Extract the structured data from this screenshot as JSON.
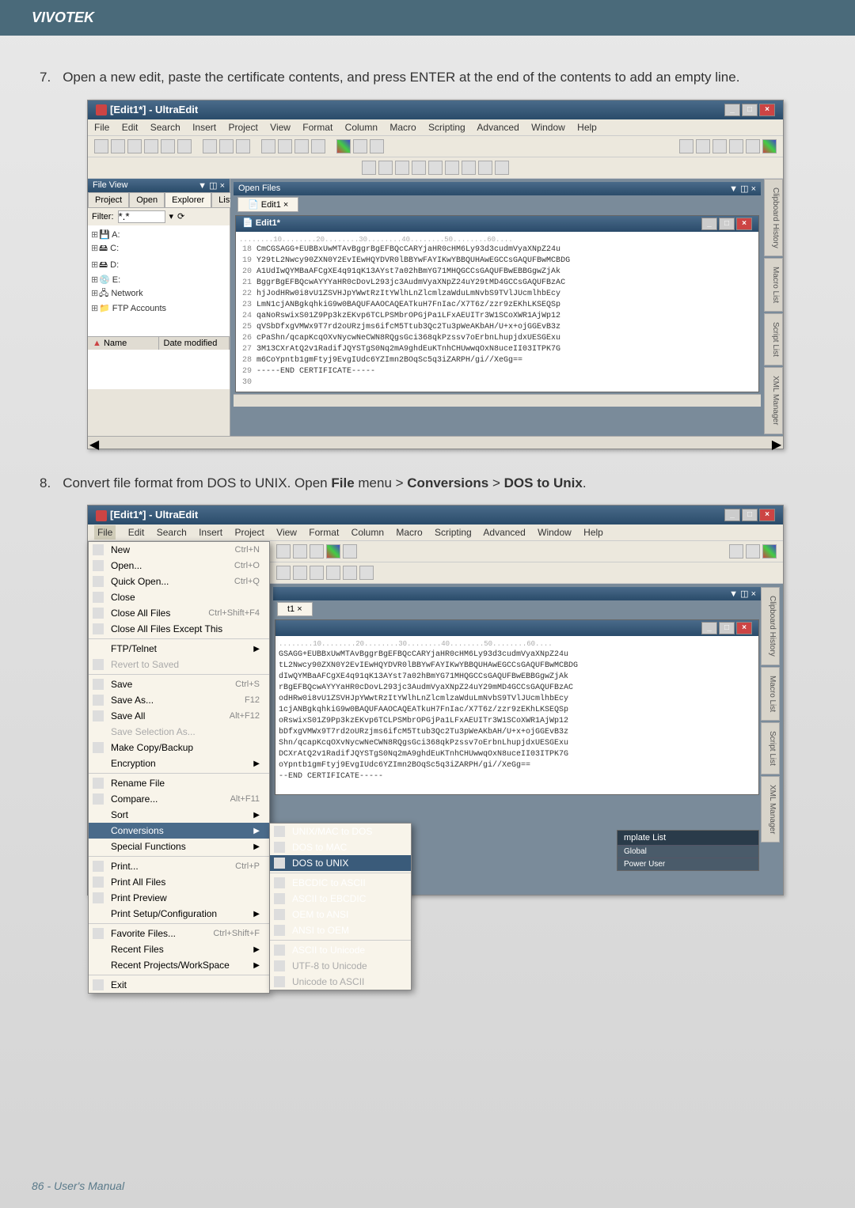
{
  "header": {
    "brand": "VIVOTEK"
  },
  "steps": {
    "step7": {
      "number": "7.",
      "text": "Open a new edit, paste the certificate contents, and press ENTER at the end of the contents to add an empty line."
    },
    "step8": {
      "number": "8.",
      "text_before": "Convert file format from DOS to UNIX. Open ",
      "bold1": "File",
      "text_mid1": " menu > ",
      "bold2": "Conversions",
      "text_mid2": " > ",
      "bold3": "DOS to Unix",
      "text_after": "."
    }
  },
  "window1": {
    "title": "[Edit1*] - UltraEdit",
    "menubar": {
      "file": "File",
      "edit": "Edit",
      "search": "Search",
      "insert": "Insert",
      "project": "Project",
      "view": "View",
      "format": "Format",
      "column": "Column",
      "macro": "Macro",
      "scripting": "Scripting",
      "advanced": "Advanced",
      "window": "Window",
      "help": "Help"
    },
    "leftpanel": {
      "header": "File View",
      "tabs": {
        "project": "Project",
        "open": "Open",
        "explorer": "Explorer",
        "lists": "Lists"
      },
      "filter_label": "Filter:",
      "filter_value": "*.*",
      "tree": {
        "a": "A:",
        "c": "C:",
        "d": "D:",
        "e": "E:",
        "network": "Network",
        "ftp": "FTP Accounts"
      },
      "list_cols": {
        "name": "Name",
        "date": "Date modified"
      }
    },
    "editor": {
      "tab_name": "Edit1",
      "tab_close": "×",
      "doc_title": "Edit1*",
      "ruler": "........10........20........30........40........50........60....",
      "lines": [
        "CmCGSAGG+EUBBxUwMTAvBggrBgEFBQcCARYjaHR0cHM6Ly93d3cudmVyaXNpZ24u",
        "Y29tL2Nwcy90ZXN0Y2EvIEwHQYDVR0lBBYwFAYIKwYBBQUHAwEGCCsGAQUFBwMCBDG",
        "A1UdIwQYMBaAFCgXE4q91qK13AYst7a02hBmYG71MHQGCCsGAQUFBwEBBGgwZjAk",
        "BggrBgEFBQcwAYYYaHR0cDovL293jc3AudmVyaXNpZ24uY29tMD4GCCsGAQUFBzAC",
        "hjJodHRw0i8vU1ZSVHJpYWwtRzItYWlhLnZlcmlzaWduLmNvbS9TVlJUcmlhbEcy",
        "LmN1cjANBgkqhkiG9w0BAQUFAAOCAQEATkuH7FnIac/X7T6z/zzr9zEKhLKSEQSp",
        "qaNoRswixS01Z9Pp3kzEKvp6TCLPSMbrOPGjPa1LFxAEUITr3W1SCoXWR1AjWp12",
        "qVSbDfxgVMWx9T7rd2oURzjms6ifcM5Ttub3Qc2Tu3pWeAKbAH/U+x+ojGGEvB3z",
        "cPaShn/qcapKcqOXvNycwNeCWN8RQgsGci368qkPzssv7oErbnLhupjdxUESGExu",
        "3M13CXrAtQ2v1RadifJQYSTgS0Nq2mA9ghdEuKTnhCHUwwqOxN8uceII03ITPK7G",
        "m6CoYpntb1gmFtyj9EvgIUdc6YZImn2BOqSc5q3iZARPH/gi//XeGg==",
        "-----END CERTIFICATE-----"
      ],
      "line_start": 18
    },
    "right_tabs": {
      "clipboard": "Clipboard History",
      "macro": "Macro List",
      "script": "Script List",
      "xml": "XML Manager"
    }
  },
  "window2": {
    "title": "[Edit1*] - UltraEdit",
    "filemenu": {
      "items": [
        {
          "label": "New",
          "shortcut": "Ctrl+N",
          "icon": true
        },
        {
          "label": "Open...",
          "shortcut": "Ctrl+O",
          "icon": true
        },
        {
          "label": "Quick Open...",
          "shortcut": "Ctrl+Q",
          "icon": true
        },
        {
          "label": "Close",
          "shortcut": "",
          "icon": true
        },
        {
          "label": "Close All Files",
          "shortcut": "Ctrl+Shift+F4",
          "icon": true
        },
        {
          "label": "Close All Files Except This",
          "shortcut": "",
          "icon": true
        },
        {
          "label": "FTP/Telnet",
          "shortcut": "",
          "submenu": true
        },
        {
          "label": "Revert to Saved",
          "shortcut": "",
          "disabled": true
        },
        {
          "label": "Save",
          "shortcut": "Ctrl+S",
          "icon": true
        },
        {
          "label": "Save As...",
          "shortcut": "F12",
          "icon": true
        },
        {
          "label": "Save All",
          "shortcut": "Alt+F12",
          "icon": true
        },
        {
          "label": "Save Selection As...",
          "shortcut": "",
          "disabled": true
        },
        {
          "label": "Make Copy/Backup",
          "shortcut": "",
          "icon": true
        },
        {
          "label": "Encryption",
          "shortcut": "",
          "submenu": true
        },
        {
          "label": "Rename File",
          "shortcut": "",
          "icon": true
        },
        {
          "label": "Compare...",
          "shortcut": "Alt+F11",
          "icon": true
        },
        {
          "label": "Sort",
          "shortcut": "",
          "submenu": true
        },
        {
          "label": "Conversions",
          "shortcut": "",
          "submenu": true,
          "highlighted": true
        },
        {
          "label": "Special Functions",
          "shortcut": "",
          "submenu": true
        },
        {
          "label": "Print...",
          "shortcut": "Ctrl+P",
          "icon": true
        },
        {
          "label": "Print All Files",
          "shortcut": "",
          "icon": true
        },
        {
          "label": "Print Preview",
          "shortcut": "",
          "icon": true
        },
        {
          "label": "Print Setup/Configuration",
          "shortcut": "",
          "submenu": true
        },
        {
          "label": "Favorite Files...",
          "shortcut": "Ctrl+Shift+F",
          "icon": true
        },
        {
          "label": "Recent Files",
          "shortcut": "",
          "submenu": true
        },
        {
          "label": "Recent Projects/WorkSpace",
          "shortcut": "",
          "submenu": true
        },
        {
          "label": "Exit",
          "shortcut": "",
          "icon": true
        }
      ]
    },
    "submenu": {
      "items": [
        {
          "label": "UNIX/MAC to DOS",
          "icon": true
        },
        {
          "label": "DOS to MAC",
          "icon": true
        },
        {
          "label": "DOS to UNIX",
          "icon": true,
          "highlighted": true
        },
        {
          "label": "EBCDIC to ASCII",
          "icon": true
        },
        {
          "label": "ASCII to EBCDIC",
          "icon": true
        },
        {
          "label": "OEM to ANSI",
          "icon": true
        },
        {
          "label": "ANSI to OEM",
          "icon": true
        },
        {
          "label": "ASCII to Unicode",
          "icon": true
        },
        {
          "label": "UTF-8 to Unicode",
          "disabled": true
        },
        {
          "label": "Unicode to ASCII",
          "disabled": true
        }
      ]
    },
    "editor": {
      "tab_name": "t1",
      "tab_close": "×",
      "lines": [
        "........10........20........30........40........50........60....",
        "GSAGG+EUBBxUwMTAvBggrBgEFBQcCARYjaHR0cHM6Ly93d3cudmVyaXNpZ24u",
        "tL2Nwcy90ZXN0Y2EvIEwHQYDVR0lBBYwFAYIKwYBBQUHAwEGCCsGAQUFBwMCBDG",
        "dIwQYMBaAFCgXE4q91qK13AYst7a02hBmYG71MHQGCCsGAQUFBwEBBGgwZjAk",
        "rBgEFBQcwAYYYaHR0cDovL293jc3AudmVyaXNpZ24uY29mMD4GCCsGAQUFBzAC",
        "odHRw0i8vU1ZSVHJpYWwtRzItYWlhLnZlcmlzaWduLmNvbS9TVlJUcmlhbEcy",
        "1cjANBgkqhkiG9w0BAQUFAAOCAQEATkuH7FnIac/X7T6z/zzr9zEKhLKSEQSp",
        "oRswixS01Z9Pp3kzEKvp6TCLPSMbrOPGjPa1LFxAEUITr3W1SCoXWR1AjWp12",
        "bDfxgVMWx9T7rd2oURzjms6ifcM5Ttub3Qc2Tu3pWeAKbAH/U+x+ojGGEvB3z",
        "Shn/qcapKcqOXvNycwNeCWN8RQgsGci368qkPzssv7oErbnLhupjdxUESGExu",
        "DCXrAtQ2v1RadifJQYSTgS0Nq2mA9ghdEuKTnhCHUwwqOxN8uceII03ITPK7G",
        "oYpntb1gmFtyj9EvgIUdc6YZImn2BOqSc5q3iZARPH/gi//XeGg==",
        "--END CERTIFICATE-----"
      ]
    },
    "template": {
      "header": "mplate List",
      "items": [
        "Global",
        "Power User"
      ]
    }
  },
  "footer": {
    "page": "86 - User's Manual"
  }
}
